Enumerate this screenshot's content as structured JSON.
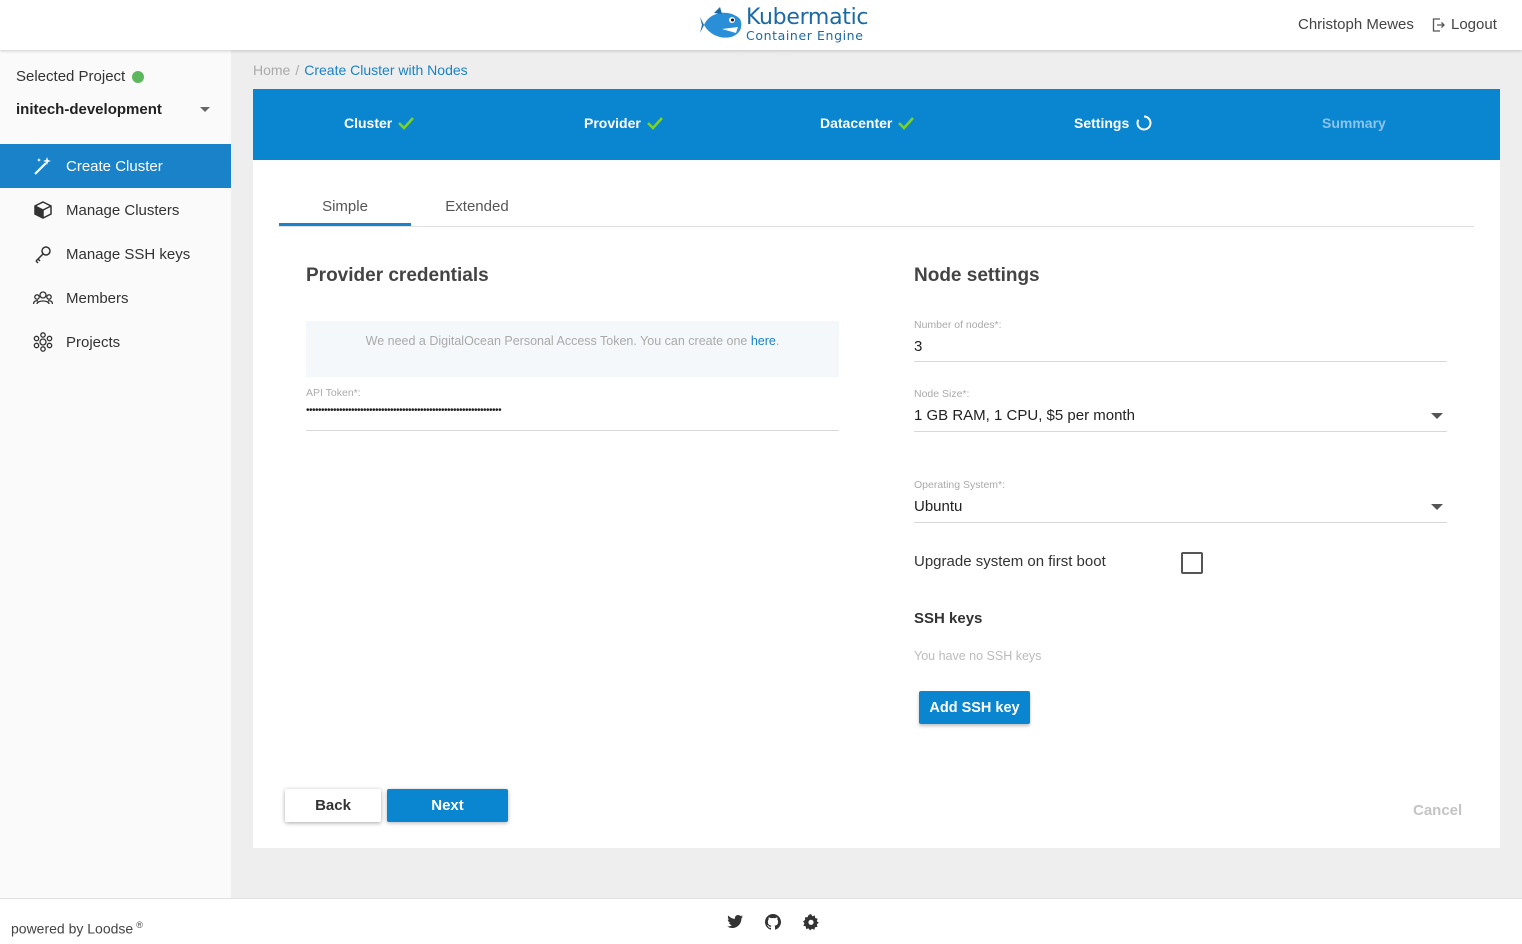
{
  "header": {
    "logo_title": "Kubermatic",
    "logo_subtitle": "Container Engine",
    "user_name": "Christoph Mewes",
    "logout_label": "Logout"
  },
  "sidebar": {
    "selected_project_label": "Selected Project",
    "project_name": "initech-development",
    "items": [
      {
        "label": "Create Cluster",
        "icon": "magic-wand-icon",
        "active": true
      },
      {
        "label": "Manage Clusters",
        "icon": "box-icon",
        "active": false
      },
      {
        "label": "Manage SSH keys",
        "icon": "key-icon",
        "active": false
      },
      {
        "label": "Members",
        "icon": "people-icon",
        "active": false
      },
      {
        "label": "Projects",
        "icon": "projects-icon",
        "active": false
      }
    ]
  },
  "breadcrumb": {
    "home": "Home",
    "separator": "/",
    "current": "Create Cluster with Nodes"
  },
  "stepper": {
    "steps": [
      {
        "label": "Cluster",
        "state": "done"
      },
      {
        "label": "Provider",
        "state": "done"
      },
      {
        "label": "Datacenter",
        "state": "done"
      },
      {
        "label": "Settings",
        "state": "active"
      },
      {
        "label": "Summary",
        "state": "pending"
      }
    ]
  },
  "tabs": [
    {
      "label": "Simple",
      "active": true
    },
    {
      "label": "Extended",
      "active": false
    }
  ],
  "provider": {
    "title": "Provider credentials",
    "info_text": "We need a DigitalOcean Personal Access Token. You can create one",
    "info_link": "here",
    "info_suffix": ".",
    "api_token_label": "API Token*:",
    "api_token_value": "•••••••••••••••••••••••••••••••••••••••••••••••••••••••••••••••••"
  },
  "node_settings": {
    "title": "Node settings",
    "nodes_label": "Number of nodes*:",
    "nodes_value": "3",
    "size_label": "Node Size*:",
    "size_value": "1 GB RAM, 1 CPU, $5 per month",
    "os_label": "Operating System*:",
    "os_value": "Ubuntu",
    "upgrade_label": "Upgrade system on first boot",
    "upgrade_checked": false,
    "ssh_title": "SSH keys",
    "ssh_empty": "You have no SSH keys",
    "add_ssh_label": "Add SSH key"
  },
  "actions": {
    "back": "Back",
    "next": "Next",
    "cancel": "Cancel"
  },
  "footer": {
    "powered_by": "powered by Loodse",
    "registered": "®",
    "icons": [
      "twitter-icon",
      "github-icon",
      "gear-icon"
    ]
  },
  "colors": {
    "accent": "#0a85cf",
    "status_green": "#5cb85c",
    "check_green": "#7ed321"
  }
}
